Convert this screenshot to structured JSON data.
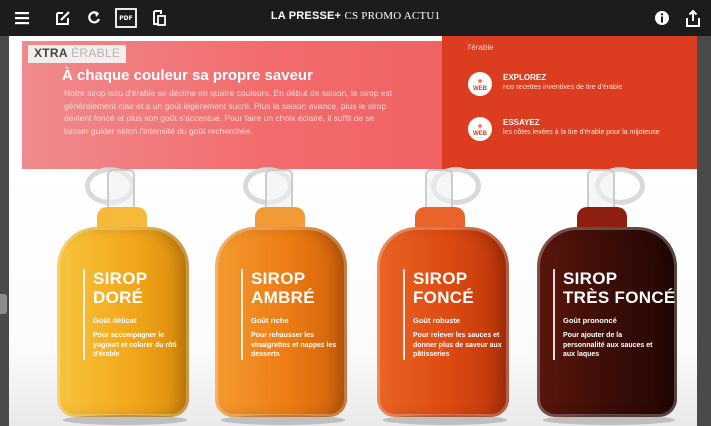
{
  "toolbar": {
    "title_brand": "LA PRESSE+",
    "title_sub": "CS PROMO ACTU1",
    "pdf_label": "PDF",
    "icons": [
      "menu-icon",
      "edit-icon",
      "refresh-icon",
      "pdf-icon",
      "copy-icon",
      "info-icon",
      "share-icon"
    ]
  },
  "section": {
    "label_bold": "XTRA",
    "label_light": "ÉRABLE"
  },
  "banner": {
    "title": "À chaque couleur sa propre saveur",
    "text": "Notre sirop issu d'érable se décline en quatre couleurs. En début de saison, le sirop est généralement clair et a un goût légèrement sucré. Plus la saison avance, plus le sirop devient foncé et plus son goût s'accentue. Pour faire un choix éclairé, il suffit de se laisser guider selon l'intensité du goût recherchée."
  },
  "sidebox": {
    "top_text": "l'érable",
    "items": [
      {
        "badge": "WEB",
        "heading": "EXPLOREZ",
        "desc": "nos recettes inventives de tire d'érable"
      },
      {
        "badge": "WEB",
        "heading": "ESSAYEZ",
        "desc": "les côtes levées à la tire d'érable pour la mijoteuse"
      }
    ]
  },
  "bottles": [
    {
      "name": "SIROP\nDORÉ",
      "taste": "Goût délicat",
      "desc": "Pour accompagner le yogourt et colorer du rôti d'érable"
    },
    {
      "name": "SIROP\nAMBRÉ",
      "taste": "Goût riche",
      "desc": "Pour rehausser les vinaigrettes et nappez les desserts"
    },
    {
      "name": "SIROP\nFONCÉ",
      "taste": "Goût robuste",
      "desc": "Pour relever les sauces et donner plus de saveur aux pâtisseries"
    },
    {
      "name": "SIROP\nTRÈS FONCÉ",
      "taste": "Goût prononcé",
      "desc": "Pour ajouter de la personnalité aux sauces et aux laques"
    }
  ],
  "colors": {
    "toolbar": "#1c1c1c",
    "banner": "#f26b6c",
    "sidebox": "#dc3c1f",
    "dore": "#f2a81c",
    "ambre": "#ec7c14",
    "fonce": "#dd4a12",
    "tres_fonce": "#3a0d08"
  }
}
